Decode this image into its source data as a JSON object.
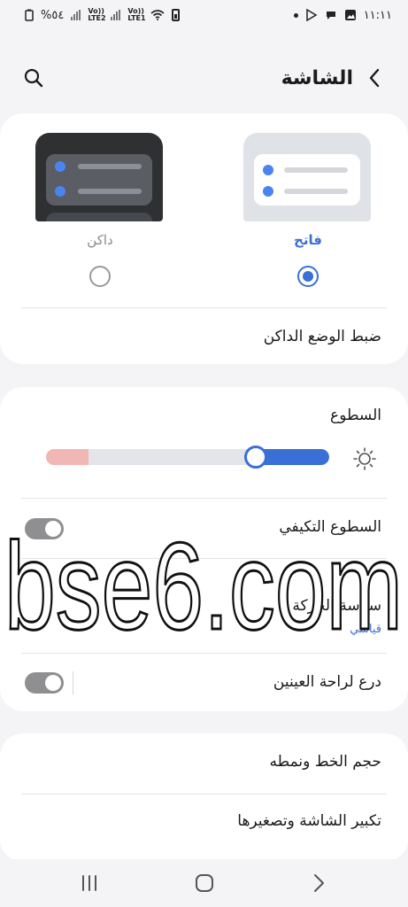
{
  "status_bar": {
    "time": "١١:١١",
    "battery_text": "%٥٤",
    "sim1_label": "Vo)) LTE2",
    "sim2_label": "Vo)) LTE1"
  },
  "header": {
    "title": "الشاشة",
    "back_icon": "chevron-left-icon",
    "search_icon": "search-icon"
  },
  "display_mode": {
    "light_label": "فاتح",
    "dark_label": "داكن",
    "selected": "light",
    "dark_mode_settings": "ضبط الوضع الداكن"
  },
  "brightness": {
    "title": "السطوع",
    "level": 0.74,
    "adaptive_label": "السطوع التكيفي",
    "adaptive_on": false,
    "motion_smoothness_label": "سلاسة الحركة",
    "motion_smoothness_value": "قياسي",
    "eye_comfort_label": "درع لراحة العينين",
    "eye_comfort_on": false
  },
  "font": {
    "font_size_label": "حجم الخط ونمطه",
    "screen_zoom_label": "تكبير الشاشة وتصغيرها"
  },
  "watermark": {
    "text": "bse6.com"
  },
  "colors": {
    "accent": "#3a6fd8",
    "background": "#f4f4f6",
    "card": "#ffffff"
  }
}
